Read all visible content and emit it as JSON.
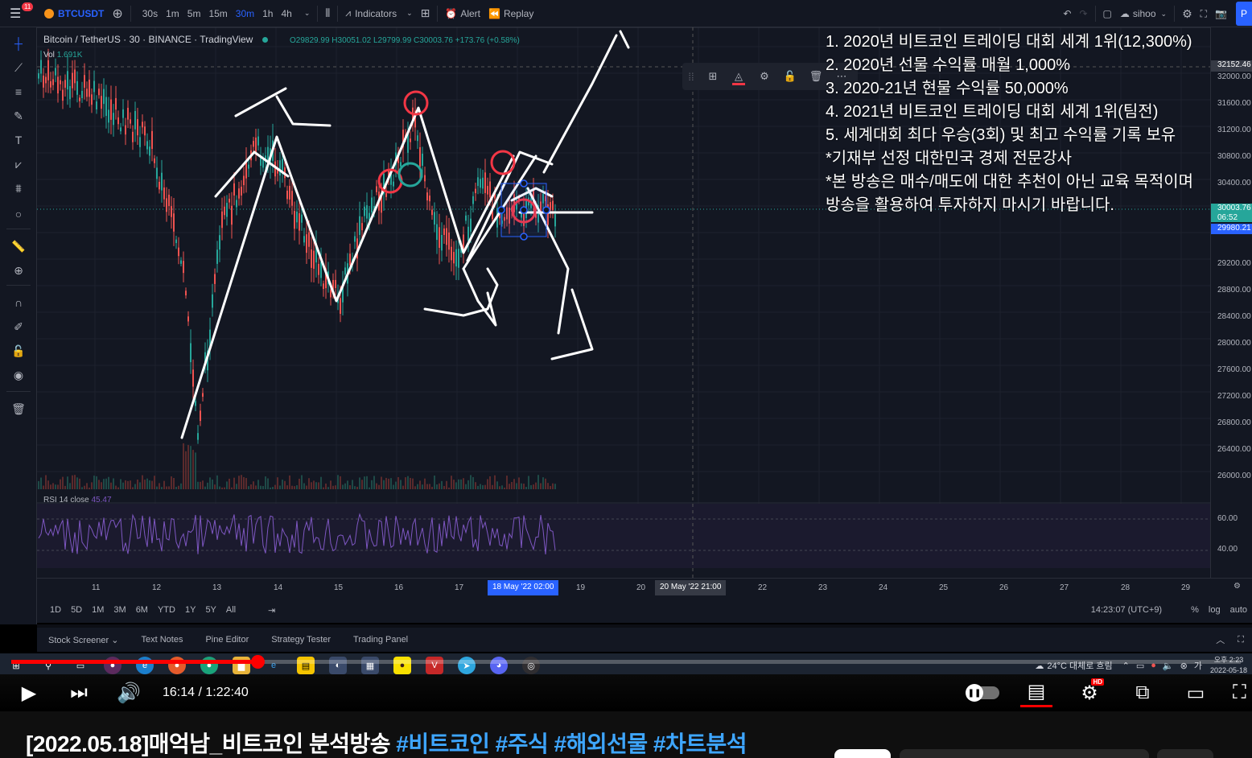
{
  "topbar": {
    "notification_count": "11",
    "symbol": "BTCUSDT",
    "intervals": [
      "30s",
      "1m",
      "5m",
      "15m",
      "30m",
      "1h",
      "4h"
    ],
    "active_interval": "30m",
    "indicators_label": "Indicators",
    "alert_label": "Alert",
    "replay_label": "Replay",
    "user_label": "sihoo",
    "publish_label": "P"
  },
  "legend": {
    "title": "Bitcoin / TetherUS · 30 · BINANCE · TradingView",
    "ohlc": "O29829.99 H30051.02 L29799.99 C30003.76 +173.76 (+0.58%)",
    "vol_label": "Vol",
    "vol_value": "1.691K",
    "rsi_label": "RSI 14 close",
    "rsi_value": "45.47"
  },
  "price_axis": {
    "labels": [
      "32000.00",
      "31600.00",
      "31200.00",
      "30800.00",
      "30400.00",
      "29200.00",
      "28800.00",
      "28400.00",
      "28000.00",
      "27600.00",
      "27200.00",
      "26800.00",
      "26400.00",
      "26000.00"
    ],
    "top_box": "32152.46",
    "current_price": "30003.76",
    "countdown": "06:52",
    "crosshair_price": "29980.21",
    "rsi_labels": [
      "60.00",
      "40.00"
    ]
  },
  "time_axis": {
    "labels": [
      "11",
      "12",
      "13",
      "14",
      "15",
      "16",
      "17",
      "19",
      "20",
      "22",
      "23",
      "24",
      "25",
      "26",
      "27",
      "28",
      "29"
    ],
    "current_date_box": "18 May '22   02:00",
    "crosshair_date_box": "20 May '22   21:00"
  },
  "range_bar": {
    "ranges": [
      "1D",
      "5D",
      "1M",
      "3M",
      "6M",
      "YTD",
      "1Y",
      "5Y",
      "All"
    ],
    "clock": "14:23:07 (UTC+9)",
    "percent": "%",
    "log": "log",
    "auto": "auto"
  },
  "panel_tabs": [
    "Stock Screener",
    "Text Notes",
    "Pine Editor",
    "Strategy Tester",
    "Trading Panel"
  ],
  "overlay_text": [
    "1. 2020년 비트코인 트레이딩 대회 세계 1위(12,300%)",
    "2. 2020년 선물 수익률 매월 1,000%",
    "3. 2020-21년 현물 수익률 50,000%",
    "4. 2021년 비트코인 트레이딩 대회 세계 1위(팀전)",
    "5. 세계대회 최다 우승(3회) 및 최고 수익률 기록 보유",
    "*기재부 선정 대한민국 경제 전문강사",
    "*본 방송은 매수/매도에 대한 추천이 아닌 교육 목적이며",
    " 방송을 활용하여 투자하지 마시기 바랍니다."
  ],
  "taskbar": {
    "weather": "24°C  대체로 흐림",
    "time": "오후 2:23",
    "date": "2022-05-18"
  },
  "youtube": {
    "progress": 0.2,
    "time": "16:14 / 1:22:40",
    "hd": "HD",
    "title_main": "[2022.05.18]매억남_비트코인 분석방송 ",
    "hashtags": "#비트코인 #주식 #해외선물 #차트분석"
  },
  "colors": {
    "up": "#26a69a",
    "down": "#ef5350",
    "background": "#131722",
    "accent": "#2962ff",
    "rsi": "#7e57c2",
    "youtube_red": "#ff0000"
  }
}
